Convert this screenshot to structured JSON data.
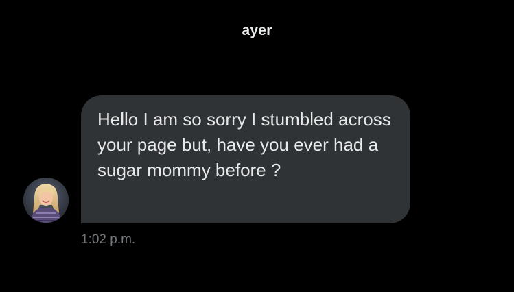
{
  "conversation": {
    "day_separator": "ayer",
    "messages": [
      {
        "direction": "received",
        "text": "Hello I am so sorry I stumbled across your page but, have you ever had a sugar mommy before ?",
        "timestamp": "1:02 p.m.",
        "avatar_icon": "user-avatar-photo"
      }
    ]
  },
  "colors": {
    "background": "#000000",
    "bubble_background": "#2f3336",
    "primary_text": "#e7e9ea",
    "secondary_text": "#71767b"
  }
}
